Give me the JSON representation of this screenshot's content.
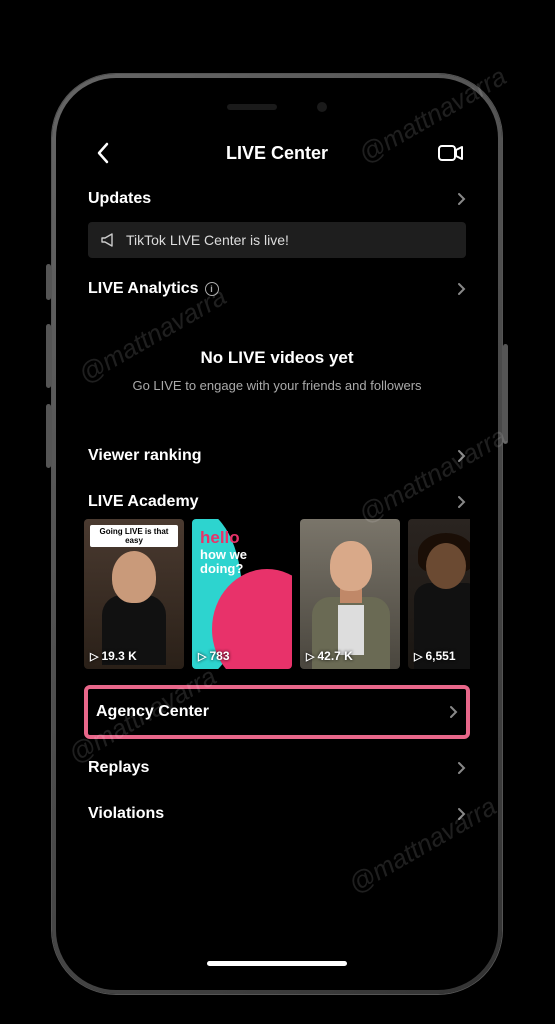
{
  "watermark": "@mattnavarra",
  "nav": {
    "title": "LIVE Center"
  },
  "sections": {
    "updates": "Updates",
    "announcement": "TikTok LIVE Center is live!",
    "analytics": "LIVE Analytics",
    "empty_title": "No LIVE videos yet",
    "empty_sub": "Go LIVE to engage with your friends and followers",
    "viewer_ranking": "Viewer ranking",
    "academy": "LIVE Academy",
    "agency": "Agency Center",
    "replays": "Replays",
    "violations": "Violations"
  },
  "academy_cards": [
    {
      "views": "19.3 K",
      "banner": "Going LIVE is that easy"
    },
    {
      "views": "783",
      "line1": "hello",
      "line2": "how we",
      "line3": "doing?"
    },
    {
      "views": "42.7 K"
    },
    {
      "views": "6,551"
    }
  ]
}
